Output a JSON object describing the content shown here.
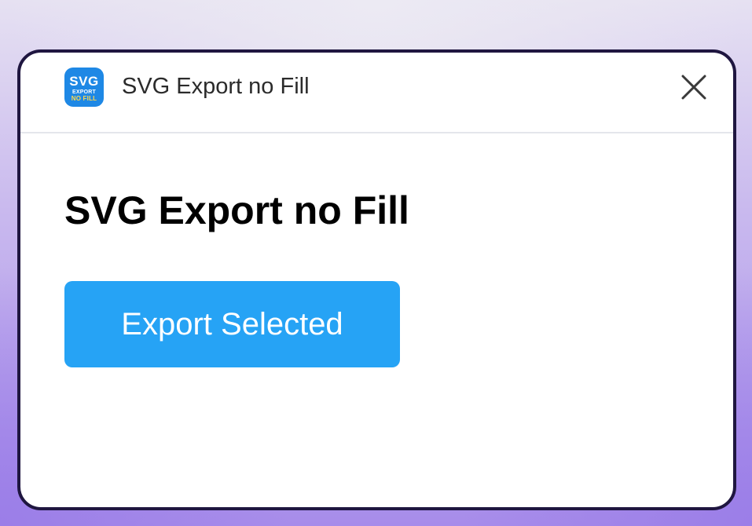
{
  "window": {
    "title": "SVG Export no Fill",
    "app_icon": {
      "name": "svg-export-no-fill-app-icon",
      "line1": "SVG",
      "line2": "EXPORT",
      "line3": "NO FILL",
      "color": "#1e88e5",
      "accent": "#ffd84d"
    },
    "close_icon": "close-icon"
  },
  "main": {
    "heading": "SVG Export no Fill",
    "export_button": {
      "label": "Export Selected",
      "color": "#26a3f5"
    }
  }
}
